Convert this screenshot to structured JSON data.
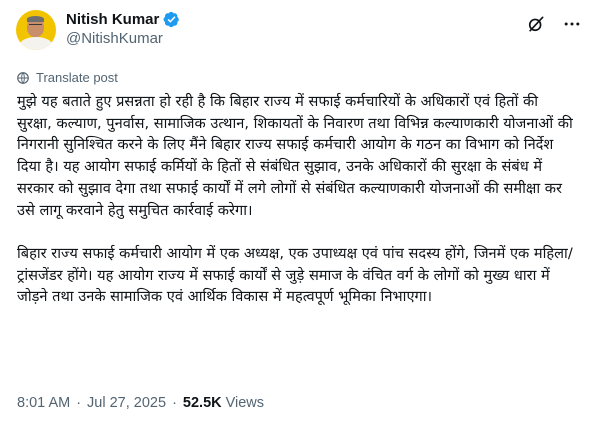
{
  "author": {
    "display_name": "Nitish Kumar",
    "handle": "@NitishKumar"
  },
  "translate_label": "Translate post",
  "tweet": {
    "paragraphs": [
      "मुझे यह बताते हुए प्रसन्नता हो रही है कि बिहार राज्य में सफाई कर्मचारियों के अधिकारों एवं हितों की सुरक्षा, कल्याण, पुनर्वास, सामाजिक उत्थान, शिकायतों के निवारण तथा विभिन्न कल्याणकारी योजनाओं की निगरानी सुनिश्चित करने के लिए मैंने बिहार राज्य सफाई कर्मचारी आयोग के गठन का विभाग को निर्देश दिया है। यह आयोग सफाई कर्मियों के हितों से संबंधित सुझाव, उनके अधिकारों की सुरक्षा के संबंध में सरकार को सुझाव देगा तथा सफाई कार्यों में लगे लोगों से संबंधित कल्याणकारी योजनाओं की समीक्षा कर उसे लागू करवाने हेतु समुचित कार्रवाई करेगा।",
      "बिहार राज्य सफाई कर्मचारी आयोग में एक अध्यक्ष, एक उपाध्यक्ष एवं पांच सदस्य होंगे, जिनमें एक महिला/ट्रांसजेंडर होंगे। यह आयोग राज्य में सफाई कार्यों से जुड़े समाज के वंचित वर्ग के लोगों को मुख्य धारा में जोड़ने तथा उनके सामाजिक एवं आर्थिक विकास में महत्वपूर्ण भूमिका निभाएगा।"
    ]
  },
  "meta": {
    "time": "8:01 AM",
    "separator": "·",
    "date": "Jul 27, 2025",
    "views_count": "52.5K",
    "views_label": "Views"
  },
  "icons": {
    "verified": "verified-badge-icon",
    "grok": "grok-icon",
    "more": "more-options-icon",
    "translate": "globe-icon"
  },
  "colors": {
    "verified": "#1d9bf0",
    "text": "#0f1419",
    "secondary": "#536471"
  }
}
